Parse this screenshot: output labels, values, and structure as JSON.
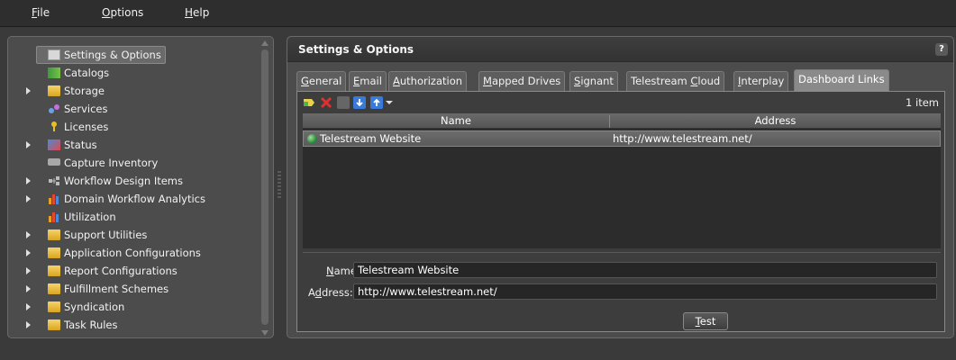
{
  "menubar": {
    "items": [
      {
        "label_u": "F",
        "label_rest": "ile"
      },
      {
        "label_u": "O",
        "label_rest": "ptions"
      },
      {
        "label_u": "H",
        "label_rest": "elp"
      }
    ]
  },
  "sidebar": {
    "items": [
      {
        "label": "Settings & Options",
        "expandable": false,
        "icon": "settings-icon",
        "selected": true
      },
      {
        "label": "Catalogs",
        "expandable": false,
        "icon": "catalogs-icon"
      },
      {
        "label": "Storage",
        "expandable": true,
        "icon": "folder-icon"
      },
      {
        "label": "Services",
        "expandable": false,
        "icon": "services-icon"
      },
      {
        "label": "Licenses",
        "expandable": false,
        "icon": "key-icon"
      },
      {
        "label": "Status",
        "expandable": true,
        "icon": "status-chart-icon"
      },
      {
        "label": "Capture Inventory",
        "expandable": false,
        "icon": "capture-icon"
      },
      {
        "label": "Workflow Design Items",
        "expandable": true,
        "icon": "workflow-icon"
      },
      {
        "label": "Domain Workflow Analytics",
        "expandable": true,
        "icon": "analytics-icon"
      },
      {
        "label": "Utilization",
        "expandable": false,
        "icon": "utilization-icon"
      },
      {
        "label": "Support Utilities",
        "expandable": true,
        "icon": "folder-icon"
      },
      {
        "label": "Application Configurations",
        "expandable": true,
        "icon": "folder-icon"
      },
      {
        "label": "Report Configurations",
        "expandable": true,
        "icon": "folder-icon"
      },
      {
        "label": "Fulfillment Schemes",
        "expandable": true,
        "icon": "folder-icon"
      },
      {
        "label": "Syndication",
        "expandable": true,
        "icon": "folder-icon"
      },
      {
        "label": "Task Rules",
        "expandable": true,
        "icon": "folder-icon"
      }
    ]
  },
  "main": {
    "title": "Settings & Options",
    "help_label": "?",
    "tabs": [
      {
        "pre": "",
        "u": "G",
        "post": "eneral"
      },
      {
        "pre": "",
        "u": "E",
        "post": "mail"
      },
      {
        "pre": "",
        "u": "A",
        "post": "uthorization"
      },
      {
        "pre": "",
        "u": "M",
        "post": "apped Drives"
      },
      {
        "pre": "",
        "u": "S",
        "post": "ignant"
      },
      {
        "pre": "Telestream ",
        "u": "C",
        "post": "loud"
      },
      {
        "pre": "",
        "u": "I",
        "post": "nterplay"
      },
      {
        "pre": "Dashboard Links",
        "u": "",
        "post": ""
      }
    ],
    "item_count": "1 item",
    "columns": [
      "Name",
      "Address"
    ],
    "rows": [
      {
        "name": "Telestream Website",
        "address": "http://www.telestream.net/"
      }
    ],
    "detail": {
      "name_label_u": "N",
      "name_label_rest": "ame:",
      "address_label_pre": "A",
      "address_label_u": "d",
      "address_label_rest": "dress:",
      "name_value": "Telestream Website",
      "address_value": "http://www.telestream.net/",
      "test_u": "T",
      "test_rest": "est"
    }
  },
  "colors": {
    "background": "#3a3a3a",
    "panel": "#4c4c4c",
    "active_tab": "#8a8a8a",
    "add_icon": "#e8d24a",
    "delete_icon": "#e03030",
    "move_icon": "#3a7ad8"
  }
}
